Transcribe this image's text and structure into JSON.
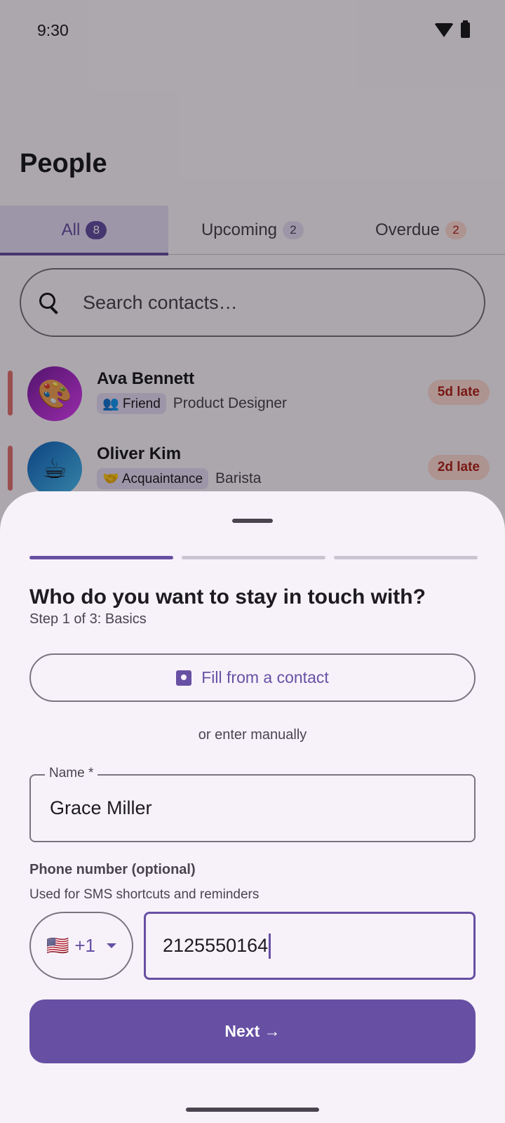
{
  "status_bar": {
    "time": "9:30",
    "icons": [
      "wifi-icon",
      "battery-icon"
    ]
  },
  "page": {
    "title": "People"
  },
  "tabs": [
    {
      "label": "All",
      "count": "8",
      "active": true
    },
    {
      "label": "Upcoming",
      "count": "2",
      "active": false
    },
    {
      "label": "Overdue",
      "count": "2",
      "active": false
    }
  ],
  "search": {
    "placeholder": "Search contacts…"
  },
  "contacts": [
    {
      "name": "Ava Bennett",
      "avatar": "🎨",
      "relationship": "👥 Friend",
      "job": "Product Designer",
      "status": "5d late"
    },
    {
      "name": "Oliver Kim",
      "avatar": "☕",
      "relationship": "🤝 Acquaintance",
      "job": "Barista",
      "status": "2d late"
    }
  ],
  "sheet": {
    "progress": {
      "step": 1,
      "total": 3
    },
    "title": "Who do you want to stay in touch with?",
    "step_label": "Step 1 of 3: Basics",
    "fill_button_label": "Fill from a contact",
    "or_text": "or enter manually",
    "name_field": {
      "label": "Name *",
      "value": "Grace Miller"
    },
    "phone": {
      "label": "Phone number (optional)",
      "helper": "Used for SMS shortcuts and reminders",
      "country_flag": "🇺🇸",
      "country_code": "+1",
      "value": "2125550164"
    },
    "next_button_label": "Next →"
  },
  "colors": {
    "accent": "#6750a4",
    "overdue": "#b3261e",
    "overdue_bg": "#ffdad6"
  }
}
